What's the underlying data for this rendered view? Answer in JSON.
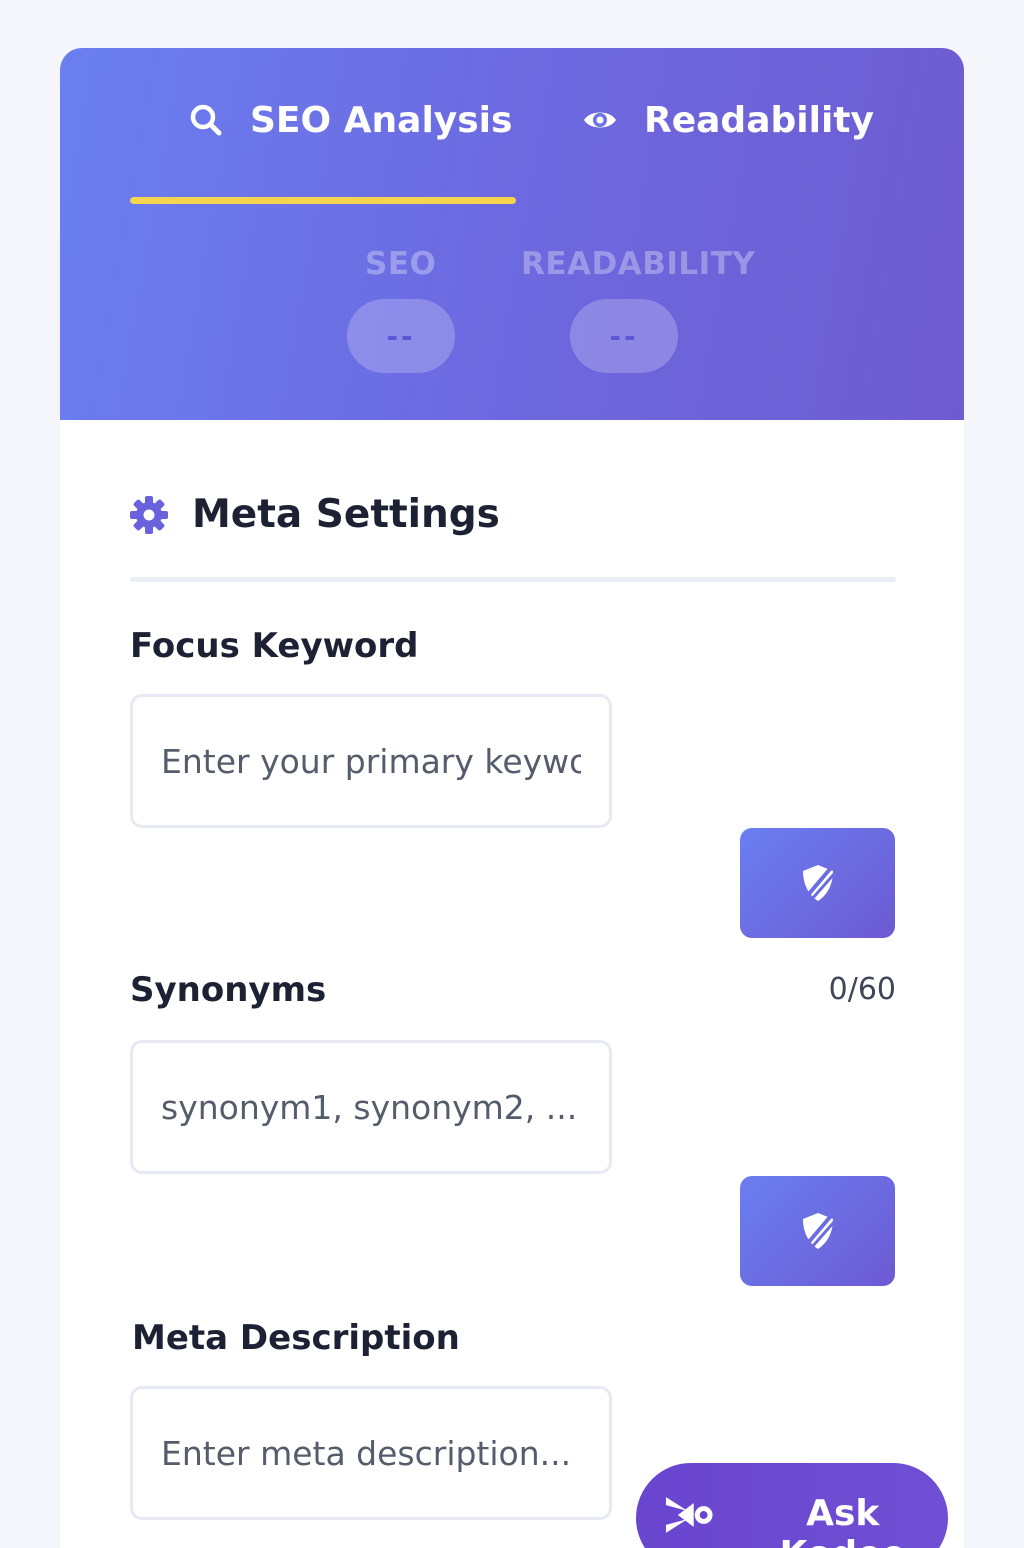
{
  "tabs": [
    {
      "label": "SEO Analysis",
      "icon": "search-icon",
      "active": true
    },
    {
      "label": "Readability",
      "icon": "eye-icon",
      "active": false
    }
  ],
  "scores": {
    "seo": {
      "label": "SEO",
      "value": "--"
    },
    "readability": {
      "label": "READABILITY",
      "value": "--"
    }
  },
  "section": {
    "title": "Meta Settings",
    "icon": "gear-icon"
  },
  "fields": {
    "focus_keyword": {
      "label": "Focus Keyword",
      "placeholder": "Enter your primary keywor",
      "value": ""
    },
    "synonyms": {
      "label": "Synonyms",
      "counter": "0/60",
      "placeholder": "synonym1, synonym2, ...",
      "value": ""
    },
    "meta_description": {
      "label": "Meta Description",
      "placeholder": "Enter meta description...",
      "value": ""
    }
  },
  "ask_button": {
    "label": "Ask Kodee",
    "icon": "kodee-icon"
  },
  "colors": {
    "header_start": "#6a7ff0",
    "header_end": "#6f5bd0",
    "indicator": "#f5d44e",
    "accent": "#6c6be0",
    "ask_button": "#6a45cf"
  }
}
